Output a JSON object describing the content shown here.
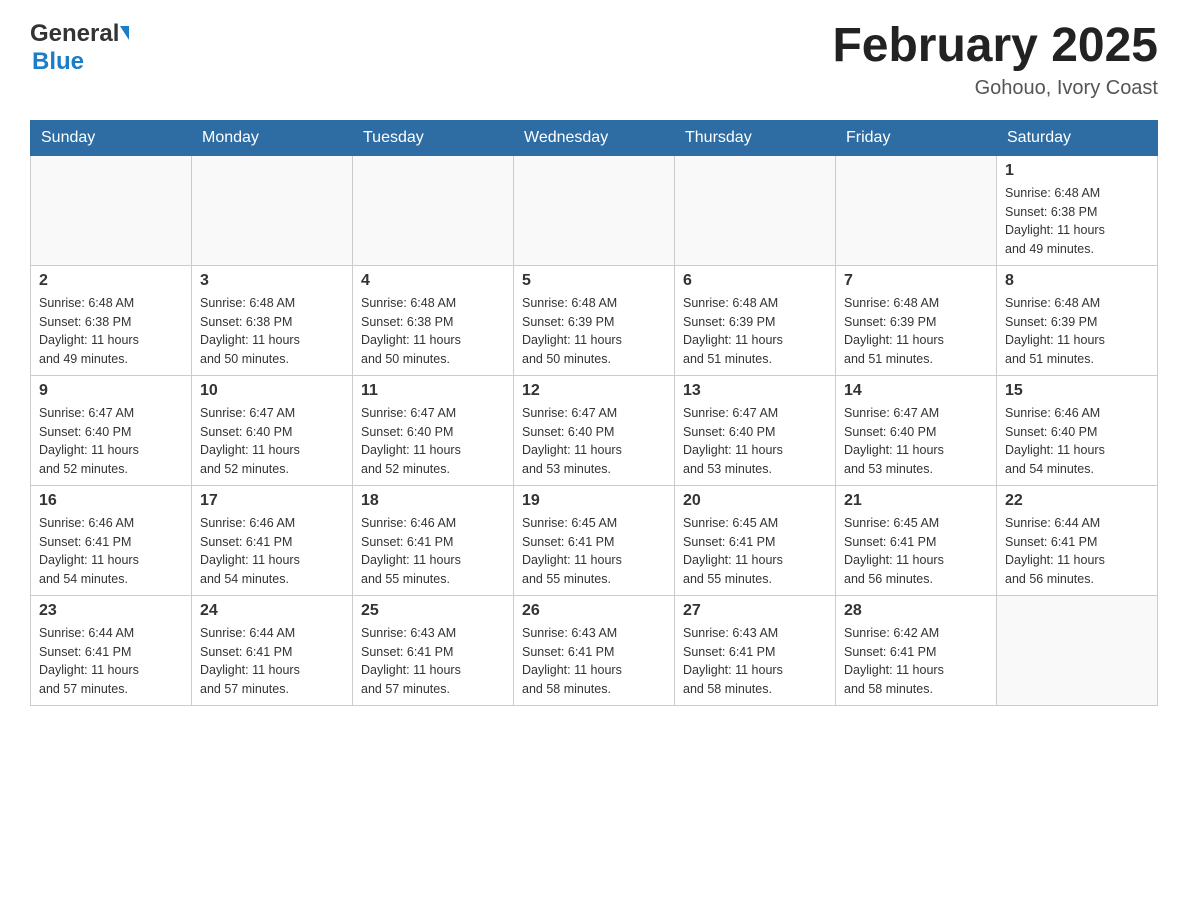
{
  "header": {
    "logo_general": "General",
    "logo_blue": "Blue",
    "month_title": "February 2025",
    "location": "Gohouo, Ivory Coast"
  },
  "weekdays": [
    "Sunday",
    "Monday",
    "Tuesday",
    "Wednesday",
    "Thursday",
    "Friday",
    "Saturday"
  ],
  "weeks": [
    [
      {
        "day": "",
        "info": ""
      },
      {
        "day": "",
        "info": ""
      },
      {
        "day": "",
        "info": ""
      },
      {
        "day": "",
        "info": ""
      },
      {
        "day": "",
        "info": ""
      },
      {
        "day": "",
        "info": ""
      },
      {
        "day": "1",
        "info": "Sunrise: 6:48 AM\nSunset: 6:38 PM\nDaylight: 11 hours\nand 49 minutes."
      }
    ],
    [
      {
        "day": "2",
        "info": "Sunrise: 6:48 AM\nSunset: 6:38 PM\nDaylight: 11 hours\nand 49 minutes."
      },
      {
        "day": "3",
        "info": "Sunrise: 6:48 AM\nSunset: 6:38 PM\nDaylight: 11 hours\nand 50 minutes."
      },
      {
        "day": "4",
        "info": "Sunrise: 6:48 AM\nSunset: 6:38 PM\nDaylight: 11 hours\nand 50 minutes."
      },
      {
        "day": "5",
        "info": "Sunrise: 6:48 AM\nSunset: 6:39 PM\nDaylight: 11 hours\nand 50 minutes."
      },
      {
        "day": "6",
        "info": "Sunrise: 6:48 AM\nSunset: 6:39 PM\nDaylight: 11 hours\nand 51 minutes."
      },
      {
        "day": "7",
        "info": "Sunrise: 6:48 AM\nSunset: 6:39 PM\nDaylight: 11 hours\nand 51 minutes."
      },
      {
        "day": "8",
        "info": "Sunrise: 6:48 AM\nSunset: 6:39 PM\nDaylight: 11 hours\nand 51 minutes."
      }
    ],
    [
      {
        "day": "9",
        "info": "Sunrise: 6:47 AM\nSunset: 6:40 PM\nDaylight: 11 hours\nand 52 minutes."
      },
      {
        "day": "10",
        "info": "Sunrise: 6:47 AM\nSunset: 6:40 PM\nDaylight: 11 hours\nand 52 minutes."
      },
      {
        "day": "11",
        "info": "Sunrise: 6:47 AM\nSunset: 6:40 PM\nDaylight: 11 hours\nand 52 minutes."
      },
      {
        "day": "12",
        "info": "Sunrise: 6:47 AM\nSunset: 6:40 PM\nDaylight: 11 hours\nand 53 minutes."
      },
      {
        "day": "13",
        "info": "Sunrise: 6:47 AM\nSunset: 6:40 PM\nDaylight: 11 hours\nand 53 minutes."
      },
      {
        "day": "14",
        "info": "Sunrise: 6:47 AM\nSunset: 6:40 PM\nDaylight: 11 hours\nand 53 minutes."
      },
      {
        "day": "15",
        "info": "Sunrise: 6:46 AM\nSunset: 6:40 PM\nDaylight: 11 hours\nand 54 minutes."
      }
    ],
    [
      {
        "day": "16",
        "info": "Sunrise: 6:46 AM\nSunset: 6:41 PM\nDaylight: 11 hours\nand 54 minutes."
      },
      {
        "day": "17",
        "info": "Sunrise: 6:46 AM\nSunset: 6:41 PM\nDaylight: 11 hours\nand 54 minutes."
      },
      {
        "day": "18",
        "info": "Sunrise: 6:46 AM\nSunset: 6:41 PM\nDaylight: 11 hours\nand 55 minutes."
      },
      {
        "day": "19",
        "info": "Sunrise: 6:45 AM\nSunset: 6:41 PM\nDaylight: 11 hours\nand 55 minutes."
      },
      {
        "day": "20",
        "info": "Sunrise: 6:45 AM\nSunset: 6:41 PM\nDaylight: 11 hours\nand 55 minutes."
      },
      {
        "day": "21",
        "info": "Sunrise: 6:45 AM\nSunset: 6:41 PM\nDaylight: 11 hours\nand 56 minutes."
      },
      {
        "day": "22",
        "info": "Sunrise: 6:44 AM\nSunset: 6:41 PM\nDaylight: 11 hours\nand 56 minutes."
      }
    ],
    [
      {
        "day": "23",
        "info": "Sunrise: 6:44 AM\nSunset: 6:41 PM\nDaylight: 11 hours\nand 57 minutes."
      },
      {
        "day": "24",
        "info": "Sunrise: 6:44 AM\nSunset: 6:41 PM\nDaylight: 11 hours\nand 57 minutes."
      },
      {
        "day": "25",
        "info": "Sunrise: 6:43 AM\nSunset: 6:41 PM\nDaylight: 11 hours\nand 57 minutes."
      },
      {
        "day": "26",
        "info": "Sunrise: 6:43 AM\nSunset: 6:41 PM\nDaylight: 11 hours\nand 58 minutes."
      },
      {
        "day": "27",
        "info": "Sunrise: 6:43 AM\nSunset: 6:41 PM\nDaylight: 11 hours\nand 58 minutes."
      },
      {
        "day": "28",
        "info": "Sunrise: 6:42 AM\nSunset: 6:41 PM\nDaylight: 11 hours\nand 58 minutes."
      },
      {
        "day": "",
        "info": ""
      }
    ]
  ]
}
